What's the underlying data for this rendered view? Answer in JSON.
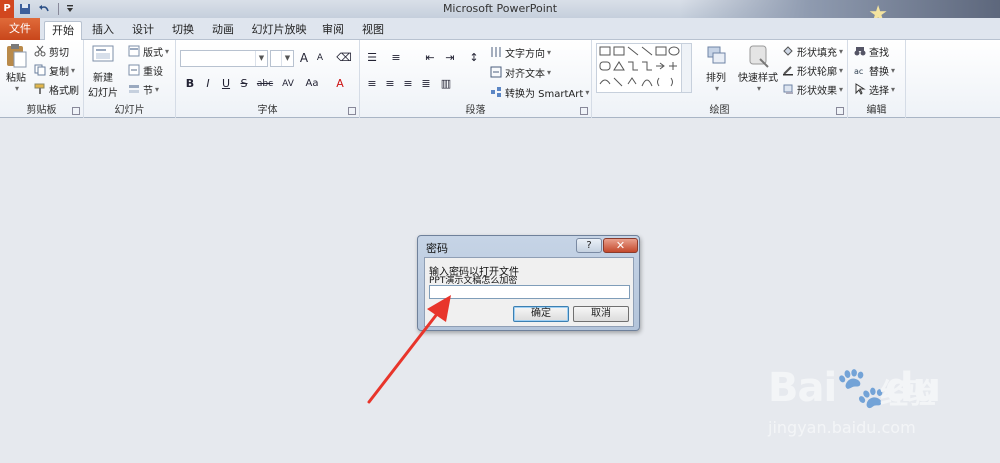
{
  "window": {
    "title": "Microsoft PowerPoint",
    "app_logo": "P"
  },
  "tabs": [
    {
      "label": "文件"
    },
    {
      "label": "开始"
    },
    {
      "label": "插入"
    },
    {
      "label": "设计"
    },
    {
      "label": "切换"
    },
    {
      "label": "动画"
    },
    {
      "label": "幻灯片放映"
    },
    {
      "label": "审阅"
    },
    {
      "label": "视图"
    }
  ],
  "ribbon": {
    "clipboard": {
      "label": "剪贴板",
      "paste": "粘贴",
      "cut": "剪切",
      "copy": "复制",
      "format_painter": "格式刷"
    },
    "slides": {
      "label": "幻灯片",
      "new_slide_1": "新建",
      "new_slide_2": "幻灯片",
      "layout": "版式",
      "reset": "重设",
      "section": "节"
    },
    "font": {
      "label": "字体",
      "bold": "B",
      "italic": "I",
      "underline": "U",
      "strike": "S",
      "abc": "abc",
      "spacing": "AV",
      "case": "Aa",
      "color": "A",
      "grow": "A",
      "shrink": "A"
    },
    "paragraph": {
      "label": "段落",
      "text_direction": "文字方向",
      "align_text": "对齐文本",
      "smartart": "转换为 SmartArt"
    },
    "drawing": {
      "label": "绘图",
      "arrange": "排列",
      "quick_styles": "快速样式",
      "shape_fill": "形状填充",
      "shape_outline": "形状轮廓",
      "shape_effects": "形状效果"
    },
    "editing": {
      "label": "编辑",
      "find": "查找",
      "replace": "替换",
      "select": "选择"
    }
  },
  "dialog": {
    "title": "密码",
    "help": "?",
    "close": "✕",
    "prompt": "输入密码以打开文件",
    "filename": "PPT演示文稿怎么加密",
    "password_value": "",
    "ok": "确定",
    "cancel": "取消"
  },
  "watermark": {
    "brand": "Bai",
    "brand2": "du",
    "cn": "经验",
    "url": "jingyan.baidu.com"
  },
  "colors": {
    "file_tab": "#c8461b",
    "annotation_arrow": "#e8352b",
    "dialog_frame": "#b3c4da"
  }
}
